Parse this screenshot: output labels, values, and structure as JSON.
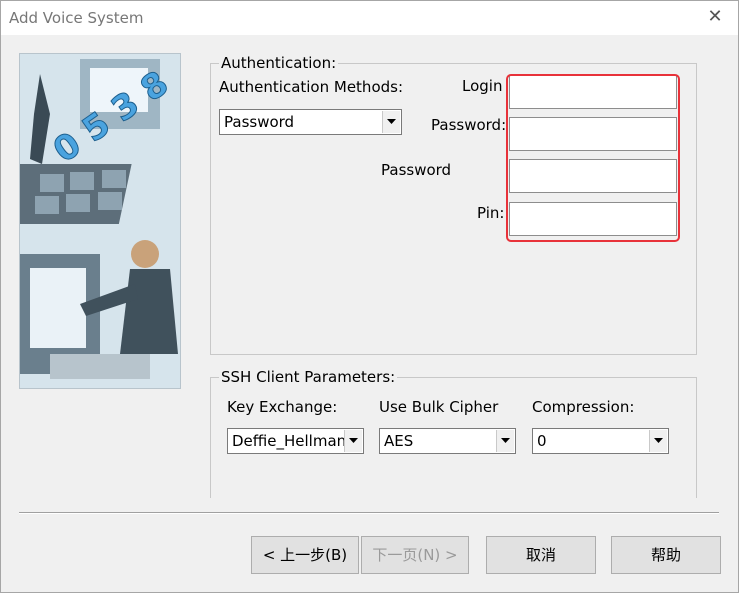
{
  "window": {
    "title": "Add Voice System"
  },
  "auth": {
    "legend": "Authentication:",
    "methods_label": "Authentication Methods:",
    "method_value": "Password",
    "login_label": "Login",
    "password_label": "Password:",
    "password2_label": "Password",
    "pin_label": "Pin:"
  },
  "ssh": {
    "legend": "SSH Client Parameters:",
    "key_exchange_label": "Key Exchange:",
    "key_exchange_value": "Deffie_Hellman",
    "bulk_cipher_label": "Use Bulk Cipher",
    "bulk_cipher_value": "AES",
    "compression_label": "Compression:",
    "compression_value": "0"
  },
  "buttons": {
    "back": "< 上一步(B)",
    "next": "下一页(N) >",
    "cancel": "取消",
    "help": "帮助"
  },
  "colors": {
    "highlight": "#e8323a",
    "window_bg": "#f0f0f0"
  }
}
